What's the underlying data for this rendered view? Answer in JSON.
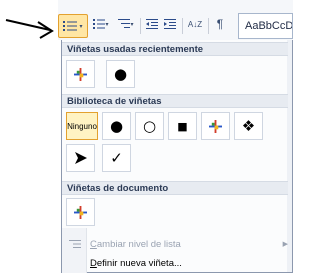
{
  "ribbon": {
    "style_preview": "AaBbCcDc",
    "sort_label": "A↓Z",
    "pilcrow": "¶"
  },
  "menu": {
    "recent": {
      "header": "Viñetas usadas recientemente"
    },
    "library": {
      "header": "Biblioteca de viñetas",
      "none_label": "Ninguno"
    },
    "document": {
      "header": "Viñetas de documento"
    },
    "items": {
      "change_level": "Cambiar nivel de lista",
      "change_level_hotkey": "C",
      "change_level_rest": "ambiar nivel de lista",
      "define_new": "Definir nueva viñeta...",
      "define_new_hotkey": "D",
      "define_new_rest": "efinir nueva viñeta..."
    }
  },
  "colors": {
    "accent": "#e3a12f",
    "selected_bg": "#fff3c3",
    "header_bg": "#e7ebf1"
  }
}
